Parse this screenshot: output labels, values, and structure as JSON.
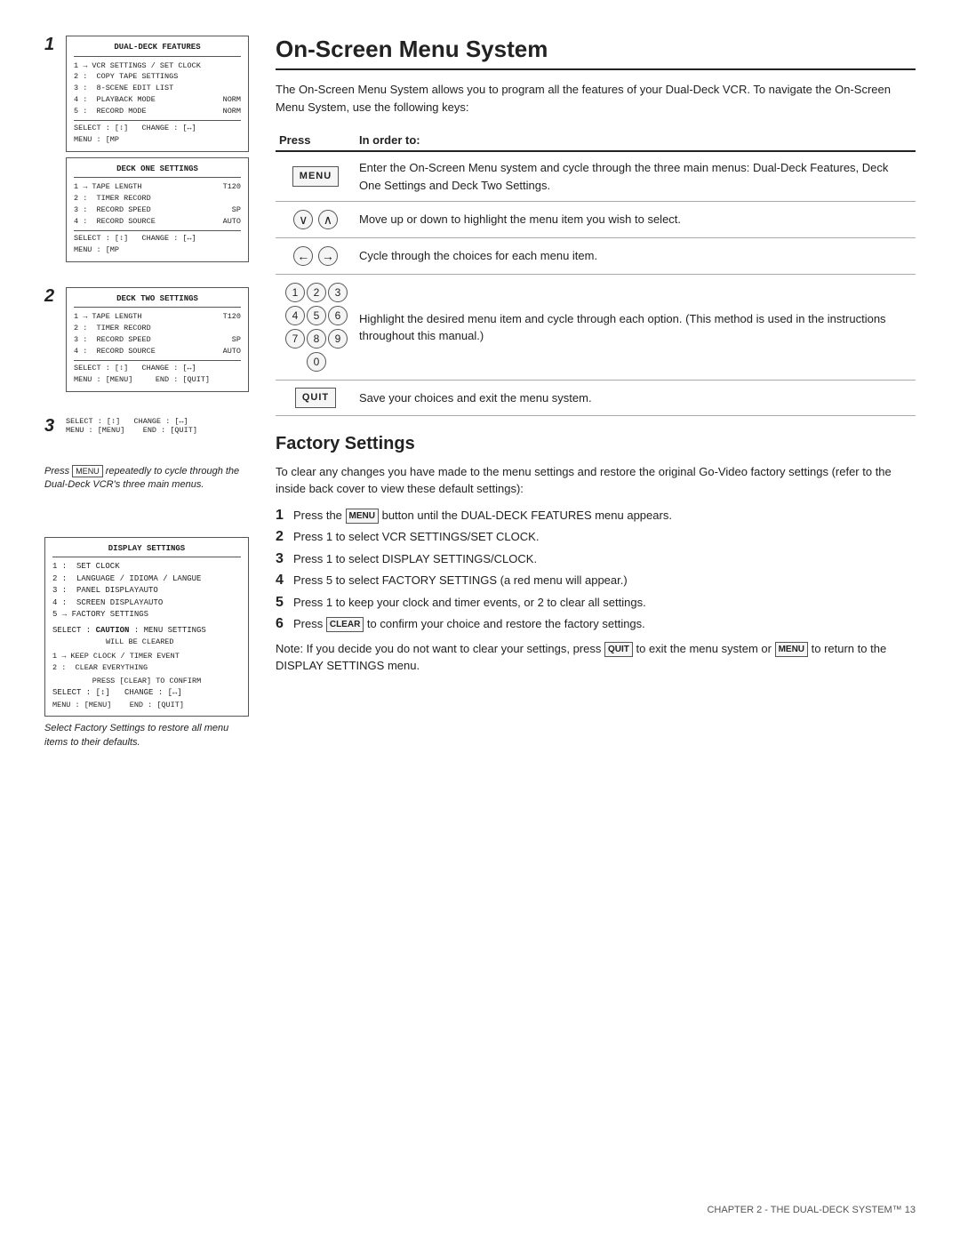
{
  "page": {
    "title": "On-Screen Menu System",
    "intro": "The On-Screen Menu System allows you to program all the features of your Dual-Deck VCR. To navigate the On-Screen Menu System, use the following keys:",
    "table": {
      "col1": "Press",
      "col2": "In order to:",
      "rows": [
        {
          "key": "MENU",
          "key_type": "box",
          "description": "Enter the On-Screen Menu system and cycle through the three main menus: Dual-Deck Features, Deck One Settings and Deck Two Settings."
        },
        {
          "key": "↓ ↑",
          "key_type": "circles",
          "description": "Move up or down to highlight the menu item you wish to select."
        },
        {
          "key": "← →",
          "key_type": "circles",
          "description": "Cycle through the choices for each menu item."
        },
        {
          "key": "1-9",
          "key_type": "numpad",
          "description": "Highlight the desired menu item and cycle through each option. (This method is used in the instructions throughout this manual.)"
        },
        {
          "key": "QUIT",
          "key_type": "box",
          "description": "Save your choices and exit the menu system."
        }
      ]
    },
    "factory_settings": {
      "title": "Factory Settings",
      "intro": "To clear any changes you have made to the menu settings and restore the original Go-Video factory settings (refer to the inside back cover to view these default settings):",
      "steps": [
        "Press the MENU button until the DUAL-DECK FEATURES menu appears.",
        "Press 1 to select VCR SETTINGS/SET CLOCK.",
        "Press 1 to select DISPLAY SETTINGS/CLOCK.",
        "Press 5 to select FACTORY SETTINGS (a red menu will appear.)",
        "Press 1 to keep your clock and timer events, or 2 to clear all settings.",
        "Press CLEAR to confirm your choice and restore the factory settings."
      ],
      "note": "Note: If you decide you do not want to clear your settings, press QUIT to exit the menu system or MENU to return to the DISPLAY SETTINGS menu."
    },
    "footer": "CHAPTER 2 - THE DUAL-DECK SYSTEM™  13",
    "left": {
      "diagram1": {
        "title": "DUAL-DECK FEATURES",
        "items": [
          "1 → VCR SETTINGS / SET CLOCK",
          "2 :  COPY TAPE SETTINGS",
          "3 :  8-SCENE EDIT LIST",
          "4 :  PLAYBACK MODE          NORM",
          "5 :  RECORD MODE            NORM"
        ],
        "select": "SELECT : [↕]   CHANGE : [↔]",
        "menu": "MENU : [MP"
      },
      "step1": "1",
      "diagram2": {
        "title": "DECK ONE SETTINGS",
        "items": [
          "1 → TAPE LENGTH                T120",
          "2 :  TIMER RECORD",
          "3 :  RECORD SPEED               SP",
          "4 :  RECORD SOURCE           AUTO"
        ],
        "select": "SELECT : [↕]   CHANGE : [↔]",
        "menu": "MENU : [MP"
      },
      "step2": "2",
      "diagram3": {
        "title": "DECK TWO SETTINGS",
        "items": [
          "1 → TAPE LENGTH                T120",
          "2 :  TIMER RECORD",
          "3 :  RECORD SPEED               SP",
          "4 :  RECORD SOURCE           AUTO"
        ],
        "select": "SELECT : [↕]   CHANGE : [↔]",
        "menu": "MENU : [MENU]      END : [QUIT]"
      },
      "step3": "3",
      "caption1": "Press MENU repeatedly to cycle through the Dual-Deck VCR's three main menus.",
      "diagram_display": {
        "title": "DISPLAY SETTINGS",
        "items": [
          "1 :  SET CLOCK",
          "2 :  LANGUAGE / IDIOMA / LANGUE",
          "3 :  PANEL DISPLAY               AUTO",
          "4 :  SCREEN DISPLAY            AUTO",
          "5 → FACTORY SETTINGS"
        ],
        "caution": "CAUTION : MENU SETTINGS\n              WILL BE CLEARED",
        "select": "SELECT : [↕]   CHANGE : [↔]",
        "menu": "MENU : [MENU]      END : [QUIT]"
      },
      "sub_menu": {
        "items": [
          "1 → KEEP CLOCK / TIMER EVENT",
          "2 :   CLEAR EVERYTHING"
        ],
        "press": "PRESS [CLEAR] TO CONFIRM"
      },
      "caption2": "Select Factory Settings to restore all menu items to their defaults."
    }
  }
}
